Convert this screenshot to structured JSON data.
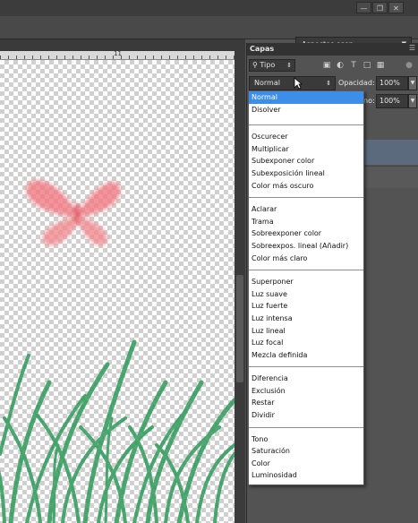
{
  "app": {
    "workspace_label": "Aspectos esen."
  },
  "document": {
    "ruler_number": "11"
  },
  "layers_panel": {
    "tab_label": "Capas",
    "filter_kind": "Tipo",
    "blend_mode": "Normal",
    "opacity_label": "Opacidad:",
    "opacity_value": "100%",
    "fill_label_partial": "no:",
    "fill_value": "100%"
  },
  "blend_menu": {
    "groups": [
      [
        "Normal",
        "Disolver"
      ],
      [
        "Oscurecer",
        "Multiplicar",
        "Subexponer color",
        "Subexposición lineal",
        "Color más oscuro"
      ],
      [
        "Aclarar",
        "Trama",
        "Sobreexponer color",
        "Sobreexpos. lineal (Añadir)",
        "Color más claro"
      ],
      [
        "Superponer",
        "Luz suave",
        "Luz fuerte",
        "Luz intensa",
        "Luz lineal",
        "Luz focal",
        "Mezcla definida"
      ],
      [
        "Diferencia",
        "Exclusión",
        "Restar",
        "Dividir"
      ],
      [
        "Tono",
        "Saturación",
        "Color",
        "Luminosidad"
      ]
    ],
    "selected": "Normal"
  },
  "colors": {
    "selection_blue": "#3d8ee8",
    "butterfly": "#f06a70",
    "grass": "#2f9a5a"
  }
}
